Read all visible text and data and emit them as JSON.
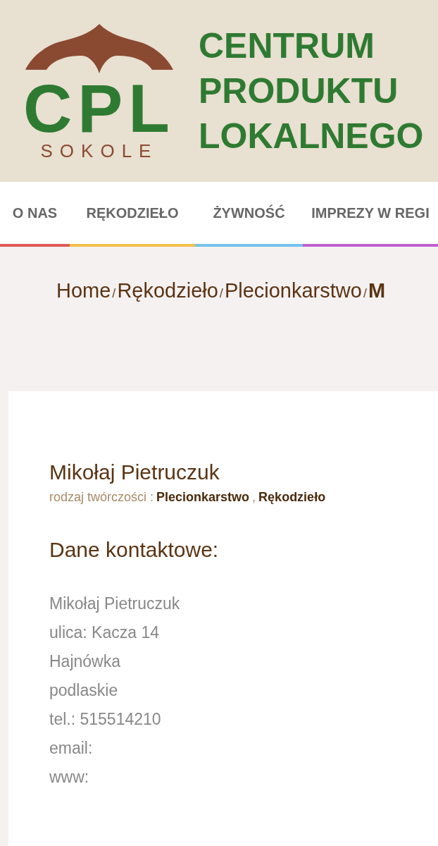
{
  "header": {
    "logo_letters": "CPL",
    "logo_subtitle": "SOKOLE",
    "title_lines": [
      "CENTRUM",
      "PRODUKTU",
      "LOKALNEGO"
    ]
  },
  "nav": [
    {
      "label": "O NAS",
      "color": "#e05a55"
    },
    {
      "label": "RĘKODZIEŁO",
      "color": "#f2c04c"
    },
    {
      "label": "ŻYWNOŚĆ",
      "color": "#72c3ea"
    },
    {
      "label": "IMPREZY W REGI",
      "color": "#c05fd0"
    }
  ],
  "breadcrumb": [
    {
      "label": "Home",
      "current": false
    },
    {
      "label": "Rękodzieło",
      "current": false
    },
    {
      "label": "Plecionkarstwo",
      "current": false
    },
    {
      "label": "M",
      "current": true
    }
  ],
  "breadcrumb_separator": "/",
  "profile": {
    "name": "Mikołaj Pietruczuk",
    "category_label": "rodzaj twórczości :",
    "categories": [
      "Plecionkarstwo",
      "Rękodzieło"
    ],
    "category_separator": ",",
    "contact_heading": "Dane kontaktowe:",
    "contact_lines": [
      "Mikołaj Pietruczuk",
      "ulica: Kacza 14",
      "Hajnówka",
      "podlaskie",
      "tel.: 515514210",
      "email:",
      "www:"
    ]
  }
}
